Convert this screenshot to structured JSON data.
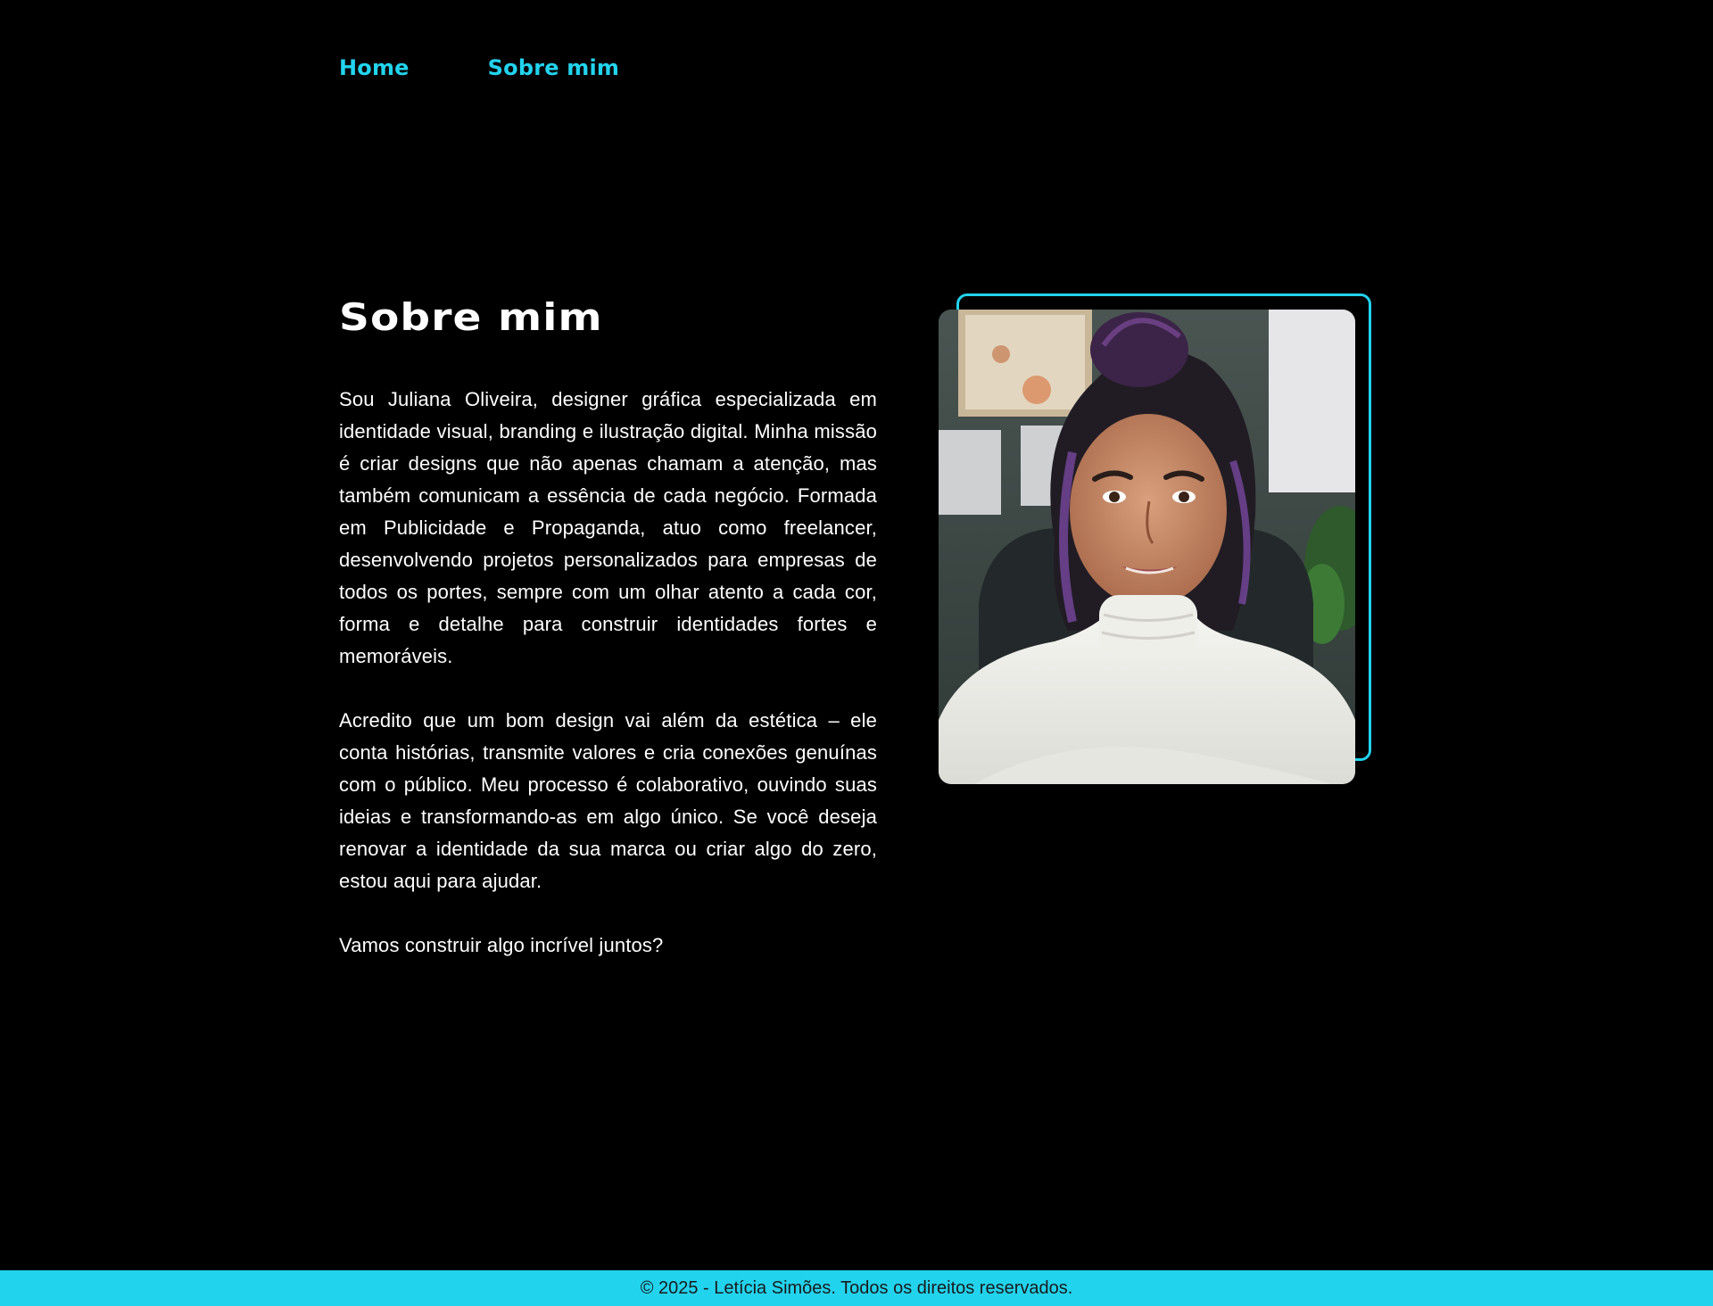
{
  "colors": {
    "accent": "#22d3ee",
    "background": "#000000",
    "text": "#ffffff",
    "footer_text": "#1a1a1a"
  },
  "nav": {
    "items": [
      {
        "label": "Home"
      },
      {
        "label": "Sobre mim"
      }
    ]
  },
  "main": {
    "title": "Sobre mim",
    "paragraphs": [
      "Sou Juliana Oliveira, designer gráfica especializada em identidade visual, branding e ilustração digital. Minha missão é criar designs que não apenas chamam a atenção, mas também comunicam a essência de cada negócio. Formada em Publicidade e Propaganda, atuo como freelancer, desenvolvendo projetos personalizados para empresas de todos os portes, sempre com um olhar atento a cada cor, forma e detalhe para construir identidades fortes e memoráveis.",
      "Acredito que um bom design vai além da estética – ele conta histórias, transmite valores e cria conexões genuínas com o público. Meu processo é colaborativo, ouvindo suas ideias e transformando-as em algo único. Se você deseja renovar a identidade da sua marca ou criar algo do zero, estou aqui para ajudar.",
      "Vamos construir algo incrível juntos?"
    ]
  },
  "photo": {
    "icon": "portrait-photo"
  },
  "footer": {
    "text": "© 2025 - Letícia Simões. Todos os direitos reservados."
  }
}
